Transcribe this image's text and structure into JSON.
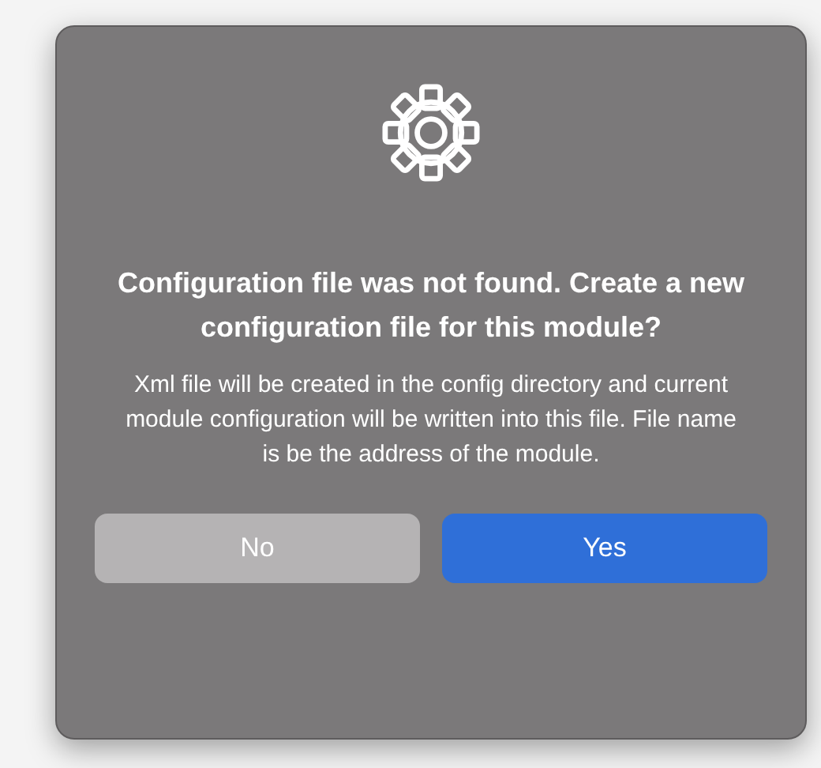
{
  "dialog": {
    "title": "Configuration file was not found. Create a new configuration file for this module?",
    "message": "Xml file will be created in the config directory and current module configuration will be written into this file. File name is be the address of the module.",
    "buttons": [
      {
        "label": "No",
        "kind": "secondary"
      },
      {
        "label": "Yes",
        "kind": "primary"
      }
    ]
  }
}
